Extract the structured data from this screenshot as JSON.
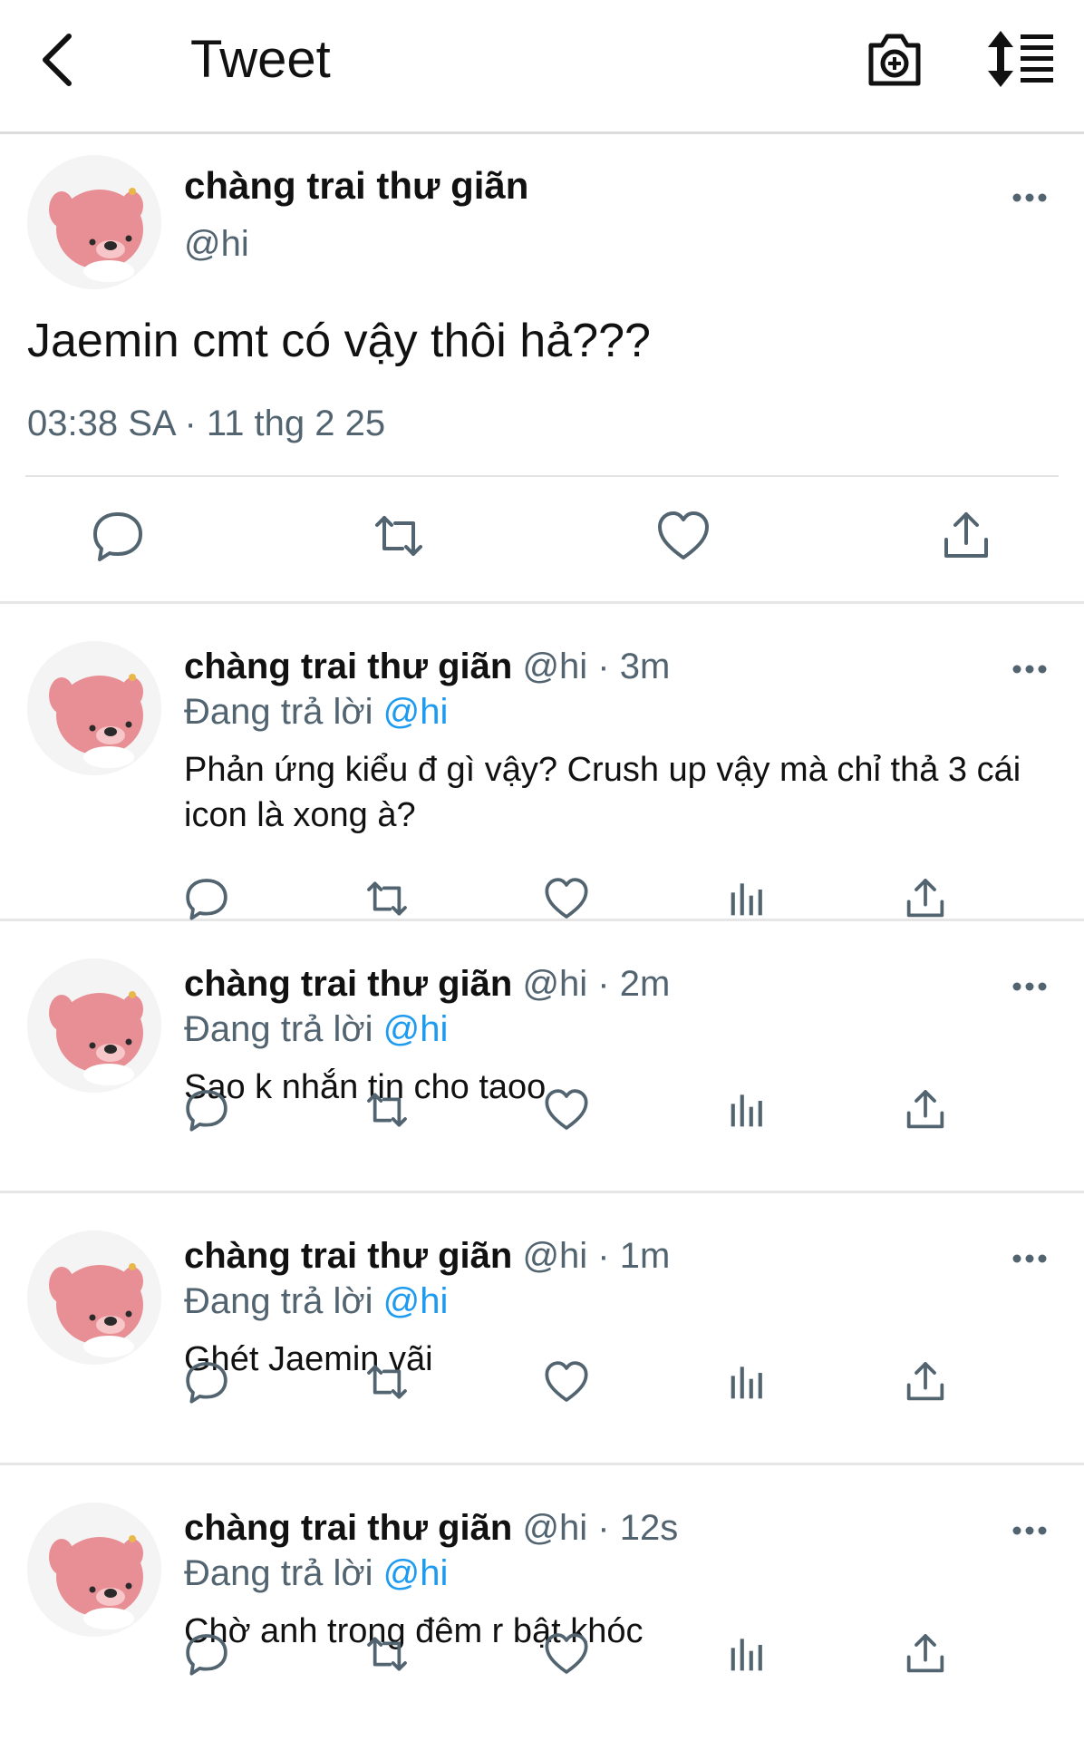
{
  "header": {
    "title": "Tweet",
    "icons": [
      "back-arrow-icon",
      "camera-plus-icon",
      "sort-lines-icon"
    ]
  },
  "main_tweet": {
    "name": "chàng trai thư giãn",
    "handle": "@hi",
    "text": "Jaemin cmt có vậy thôi hả???",
    "meta": "03:38 SA · 11 thg 2 25",
    "actions": [
      "reply-icon",
      "retweet-icon",
      "like-icon",
      "share-icon"
    ]
  },
  "replies": [
    {
      "name": "chàng trai thư giãn",
      "handle_time": " @hi · 3m",
      "replying_prefix": "Đang trả lời ",
      "replying_to": "@hi",
      "text": "Phản ứng kiểu đ gì vậy? Crush up vậy mà chỉ thả 3 cái icon là xong à?"
    },
    {
      "name": "chàng trai thư giãn",
      "handle_time": " @hi · 2m",
      "replying_prefix": "Đang trả lời ",
      "replying_to": "@hi",
      "text": "Sao k nhắn tin cho taoo"
    },
    {
      "name": "chàng trai thư giãn",
      "handle_time": " @hi · 1m",
      "replying_prefix": "Đang trả lời ",
      "replying_to": "@hi",
      "text": "Ghét Jaemin vãi"
    },
    {
      "name": "chàng trai thư giãn",
      "handle_time": " @hi · 12s",
      "replying_prefix": "Đang trả lời ",
      "replying_to": "@hi",
      "text": "Chờ anh trong đêm r bật khóc"
    }
  ],
  "colors": {
    "link": "#1d9bf0",
    "secondary_text": "#536471",
    "icon_gray": "#536471",
    "divider": "#e6e6e6"
  }
}
